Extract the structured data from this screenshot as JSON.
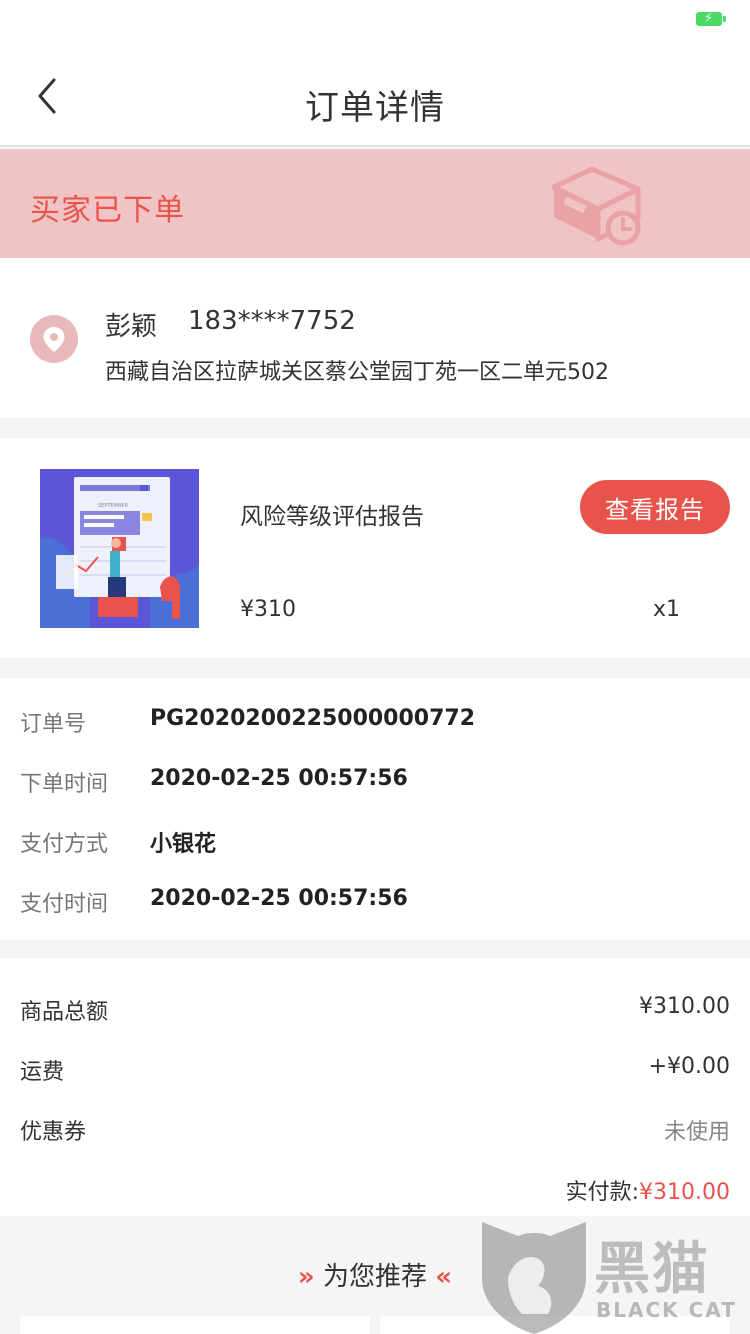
{
  "header": {
    "title": "订单详情"
  },
  "status": {
    "text": "买家已下单"
  },
  "address": {
    "name": "彭颖",
    "phone": "183****7752",
    "line": "西藏自治区拉萨城关区蔡公堂园丁苑一区二单元502"
  },
  "product": {
    "name": "风险等级评估报告",
    "button": "查看报告",
    "price": "¥310",
    "qty": "x1",
    "thumb_caption": "SEPTEMBER"
  },
  "order": {
    "rows": [
      {
        "label": "订单号",
        "value": "PG2020200225000000772"
      },
      {
        "label": "下单时间",
        "value": "2020-02-25 00:57:56"
      },
      {
        "label": "支付方式",
        "value": "小银花"
      },
      {
        "label": "支付时间",
        "value": "2020-02-25 00:57:56"
      }
    ]
  },
  "amounts": {
    "rows": [
      {
        "label": "商品总额",
        "value": "¥310.00"
      },
      {
        "label": "运费",
        "value": "+¥0.00"
      },
      {
        "label": "优惠券",
        "value": "未使用"
      }
    ],
    "paid_label": "实付款:",
    "paid_value": "¥310.00"
  },
  "recommend": {
    "title": "为您推荐"
  },
  "watermark": {
    "text": "黑猫",
    "sub": "BLACK CAT"
  },
  "colors": {
    "accent": "#e8534b",
    "banner": "#f0c3c4"
  }
}
